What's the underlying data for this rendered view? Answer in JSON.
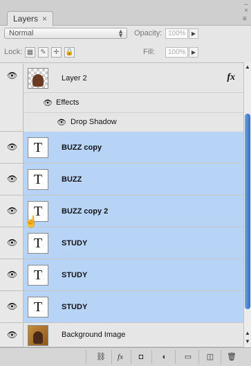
{
  "tab": {
    "label": "Layers",
    "close": "×"
  },
  "window_controls": {
    "minimize": "–",
    "close": "×",
    "menu": "≡"
  },
  "blend": {
    "mode": "Normal",
    "opacity_label": "Opacity:",
    "opacity_value": "100%"
  },
  "lock": {
    "label": "Lock:",
    "fill_label": "Fill:",
    "fill_value": "100%"
  },
  "layers": [
    {
      "name": "Layer 2",
      "selected": false,
      "kind": "image",
      "fx": "fx",
      "effects": {
        "label": "Effects",
        "items": [
          "Drop Shadow"
        ]
      }
    },
    {
      "name": "BUZZ copy",
      "selected": true,
      "kind": "text",
      "thumb": "T"
    },
    {
      "name": "BUZZ",
      "selected": true,
      "kind": "text",
      "thumb": "T"
    },
    {
      "name": "BUZZ copy 2",
      "selected": true,
      "kind": "text",
      "thumb": "T"
    },
    {
      "name": "STUDY",
      "selected": true,
      "kind": "text",
      "thumb": "T"
    },
    {
      "name": "STUDY",
      "selected": true,
      "kind": "text",
      "thumb": "T"
    },
    {
      "name": "STUDY",
      "selected": true,
      "kind": "text",
      "thumb": "T"
    },
    {
      "name": "Background Image",
      "selected": false,
      "kind": "image"
    }
  ],
  "icons": {
    "eye": "👁",
    "link": "⛓",
    "fx": "fx",
    "mask": "◘",
    "adjust": "◐",
    "folder": "▭",
    "new": "◫",
    "trash": "🗑"
  },
  "colors": {
    "selection": "#b7d4f7",
    "scroll": "#3a78cf"
  }
}
